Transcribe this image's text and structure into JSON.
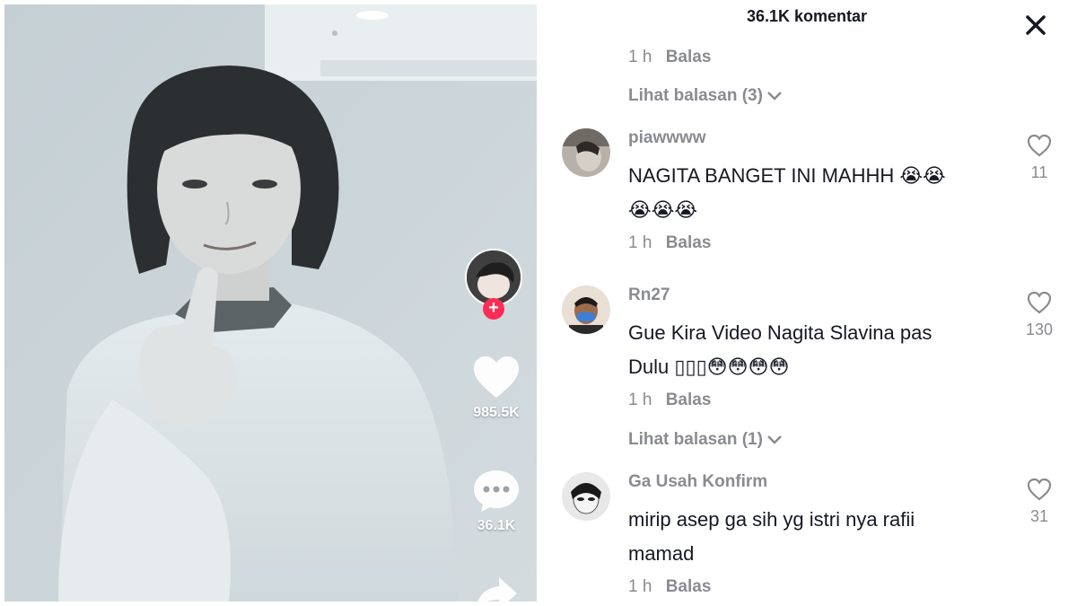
{
  "video": {
    "likes": "985.5K",
    "comments": "36.1K",
    "icons": [
      "creator-avatar",
      "follow-plus-icon",
      "heart-icon",
      "comment-icon",
      "share-icon"
    ]
  },
  "panel": {
    "title": "36.1K komentar",
    "close_icon": "close-icon",
    "top_meta": {
      "time": "1 h",
      "reply": "Balas"
    },
    "view_replies_1": "Lihat balasan (3)",
    "comments": [
      {
        "user": "piawwww",
        "text_line1": "NAGITA BANGET INI MAHHH 😭😭",
        "text_line2": "😭😭😭",
        "likes": "11",
        "time": "1 h",
        "reply": "Balas"
      },
      {
        "user": "Rn27",
        "text_line1": "Gue Kira Video Nagita Slavina pas",
        "text_line2": "Dulu ▯▯▯😳😳😳😳",
        "likes": "130",
        "time": "1 h",
        "reply": "Balas",
        "view_replies": "Lihat balasan (1)"
      },
      {
        "user": "Ga Usah Konfirm",
        "text_line1": "mirip asep ga sih yg istri nya rafii",
        "text_line2": "mamad",
        "likes": "31",
        "time": "1 h",
        "reply": "Balas"
      }
    ]
  },
  "colors": {
    "accent_red": "#fe2c55",
    "muted_text": "#8a8b91",
    "primary_text": "#161823"
  }
}
